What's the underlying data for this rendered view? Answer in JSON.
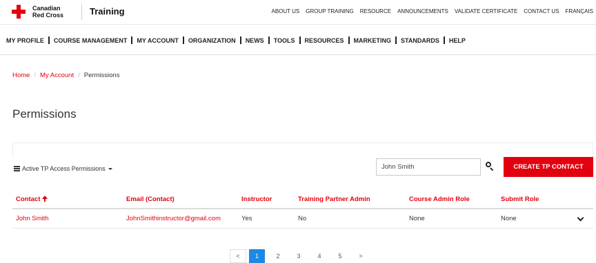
{
  "header": {
    "brand_line1": "Canadian",
    "brand_line2": "Red Cross",
    "training": "Training",
    "links": [
      "ABOUT US",
      "GROUP TRAINING",
      "RESOURCE",
      "ANNOUNCEMENTS",
      "VALIDATE CERTIFICATE",
      "CONTACT US",
      "FRANÇAIS"
    ]
  },
  "main_nav": [
    "MY PROFILE",
    "COURSE MANAGEMENT",
    "MY ACCOUNT",
    "ORGANIZATION",
    "NEWS",
    "TOOLS",
    "RESOURCES",
    "MARKETING",
    "STANDARDS",
    "HELP"
  ],
  "breadcrumb": {
    "home": "Home",
    "account": "My Account",
    "separator": "/",
    "current": "Permissions"
  },
  "page_title": "Permissions",
  "toolbar": {
    "dropdown_label": "Active TP Access Permissions",
    "search_value": "John Smith",
    "create_label": "CREATE TP CONTACT"
  },
  "table": {
    "columns": [
      "Contact",
      "Email (Contact)",
      "Instructor",
      "Training Partner Admin",
      "Course Admin Role",
      "Submit Role"
    ],
    "rows": [
      [
        "John Smith",
        "JohnSmithinstructor@gmail.com",
        "Yes",
        "No",
        "None",
        "None"
      ]
    ]
  },
  "pagination": {
    "prev": "<",
    "next": ">",
    "pages": [
      "1",
      "2",
      "3",
      "4",
      "5"
    ],
    "active": "1"
  },
  "colors": {
    "brand_red": "#e3000f",
    "active_page": "#1e88e5"
  },
  "icons": [
    "red-cross-logo",
    "list-icon",
    "caret-down-icon",
    "search-icon",
    "sort-up-icon",
    "chevron-down-icon"
  ]
}
